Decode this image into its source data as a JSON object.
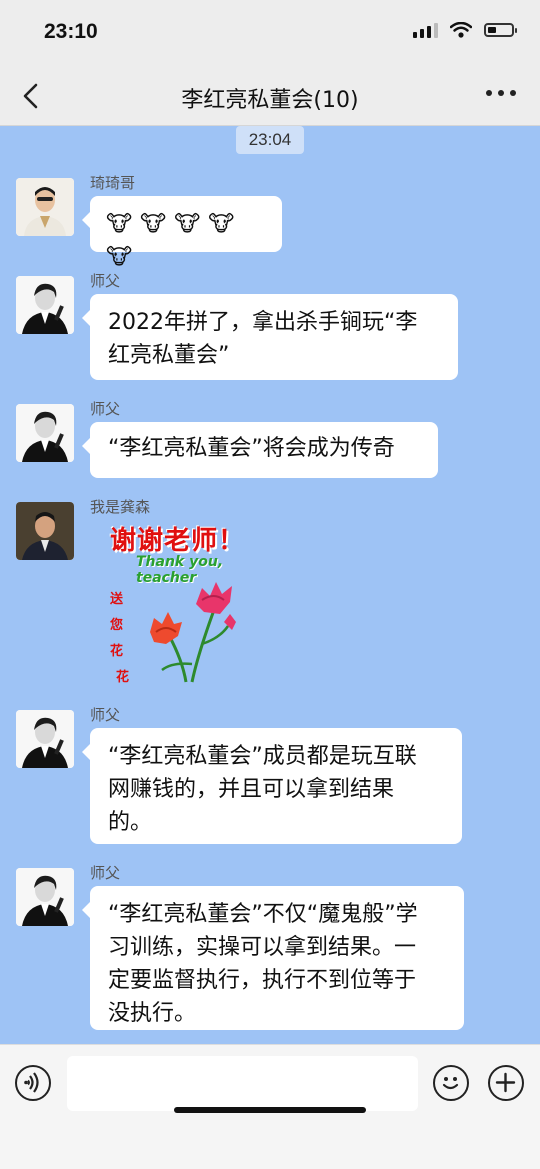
{
  "status_bar": {
    "time": "23:10",
    "battery_level": 0.35
  },
  "header": {
    "title": "李红亮私董会(10)"
  },
  "chat": {
    "timestamp": "23:04",
    "messages": [
      {
        "sender": "琦琦哥",
        "type": "emoji",
        "emojis": [
          "🐮",
          "🐮",
          "🐮",
          "🐮",
          "🐮"
        ]
      },
      {
        "sender": "师父",
        "type": "text",
        "text_lines": [
          "2022年拼了，拿出杀手锏玩“李",
          "红亮私董会”"
        ]
      },
      {
        "sender": "师父",
        "type": "text",
        "text_lines": [
          "“李红亮私董会”将会成为传奇"
        ]
      },
      {
        "sender": "我是龚森",
        "type": "sticker",
        "sticker": {
          "title": "谢谢老师！",
          "subtitle": "Thank you, teacher",
          "side_text": [
            "送",
            "您",
            "花",
            "花"
          ]
        }
      },
      {
        "sender": "师父",
        "type": "text",
        "text_lines": [
          "“李红亮私董会”成员都是玩互联",
          "网赚钱的，并且可以拿到结果",
          "的。"
        ]
      },
      {
        "sender": "师父",
        "type": "text",
        "text_lines": [
          "“李红亮私董会”不仅“魔鬼般”学",
          "习训练，实操可以拿到结果。一",
          "定要监督执行，执行不到位等于",
          "没执行。"
        ]
      }
    ]
  },
  "input_bar": {
    "placeholder": ""
  }
}
